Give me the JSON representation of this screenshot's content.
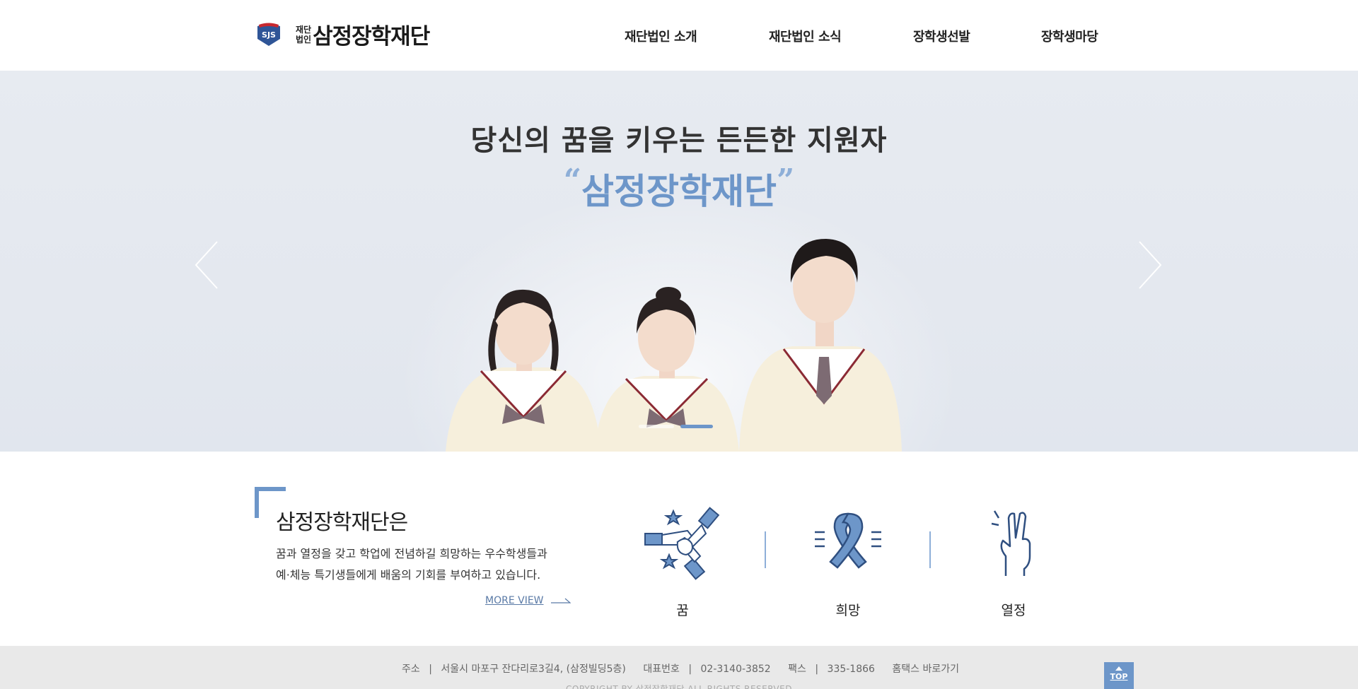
{
  "header": {
    "logo_badge": "SJS",
    "logo_small_top": "재단",
    "logo_small_bottom": "법인",
    "logo_name": "삼정장학재단",
    "nav": [
      "재단법인 소개",
      "재단법인 소식",
      "장학생선발",
      "장학생마당"
    ]
  },
  "hero": {
    "subtitle": "당신의 꿈을 키우는 든든한 지원자",
    "quote_open": "“",
    "title": "삼정장학재단",
    "quote_close": "”",
    "slides_total": 2,
    "active_slide": 2
  },
  "intro": {
    "title": "삼정장학재단은",
    "desc_line1": "꿈과 열정을 갖고 학업에 전념하길 희망하는 우수학생들과",
    "desc_line2": "예·체능 특기생들에게 배움의 기회를 부여하고 있습니다.",
    "more": "MORE VIEW",
    "values": [
      {
        "label": "꿈",
        "icon": "hands-stars-icon"
      },
      {
        "label": "희망",
        "icon": "ribbon-icon"
      },
      {
        "label": "열정",
        "icon": "victory-hand-icon"
      }
    ]
  },
  "footer": {
    "address_label": "주소",
    "address": "서울시 마포구 잔다리로3길4, (삼정빌딩5층)",
    "phone_label": "대표번호",
    "phone": "02-3140-3852",
    "fax_label": "팩스",
    "fax": "335-1866",
    "hometax": "홈택스 바로가기",
    "sep": "|",
    "copyright": "COPYRIGHT BY 삼정장학재단 ALL RIGHTS RESERVED",
    "top": "TOP"
  },
  "colors": {
    "accent": "#6d96c9",
    "hero_bg": "#e4e8ef",
    "footer_bg": "#e9e9e9"
  }
}
